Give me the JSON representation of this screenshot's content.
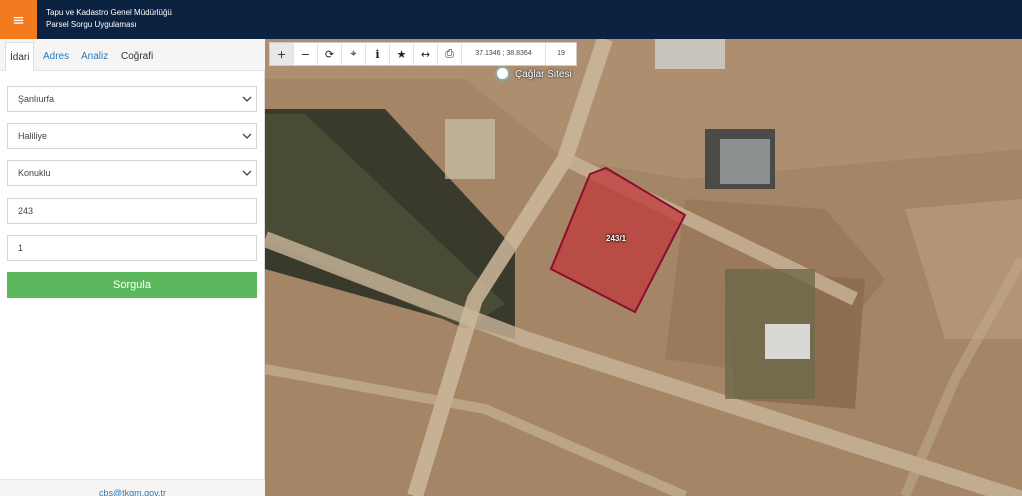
{
  "header": {
    "title_line1": "Tapu ve Kadastro Genel Müdürlüğü",
    "title_line2": "Parsel Sorgu Uygulaması",
    "menu_icon": "≡"
  },
  "sidebar": {
    "tabs": [
      {
        "label": "İdari",
        "active": true
      },
      {
        "label": "Adres",
        "active": false
      },
      {
        "label": "Analiz",
        "active": false
      },
      {
        "label": "Coğrafi",
        "active": false
      }
    ],
    "fields": {
      "il": "Şanlıurfa",
      "ilce": "Haliliye",
      "mahalle": "Konuklu",
      "ada": "243",
      "parsel": "1"
    },
    "submit_label": "Sorgula",
    "footer_email": "cbs@tkgm.gov.tr"
  },
  "map": {
    "toolbar": {
      "icons": [
        "plus-icon",
        "minus-icon",
        "refresh-icon",
        "locate-icon",
        "info-icon",
        "star-icon",
        "measure-icon",
        "print-icon"
      ],
      "coordinates": "37.1346 ; 38.8364",
      "zoom": "19"
    },
    "poi_label": "Çağlar Sitesi",
    "parcel_label": "243/1",
    "colors": {
      "parcel_fill": "#c0393b",
      "parcel_stroke": "#8a0f2e",
      "header_bg": "#0b2340",
      "menu_accent": "#f47a20",
      "submit_green": "#5cb85c"
    }
  }
}
